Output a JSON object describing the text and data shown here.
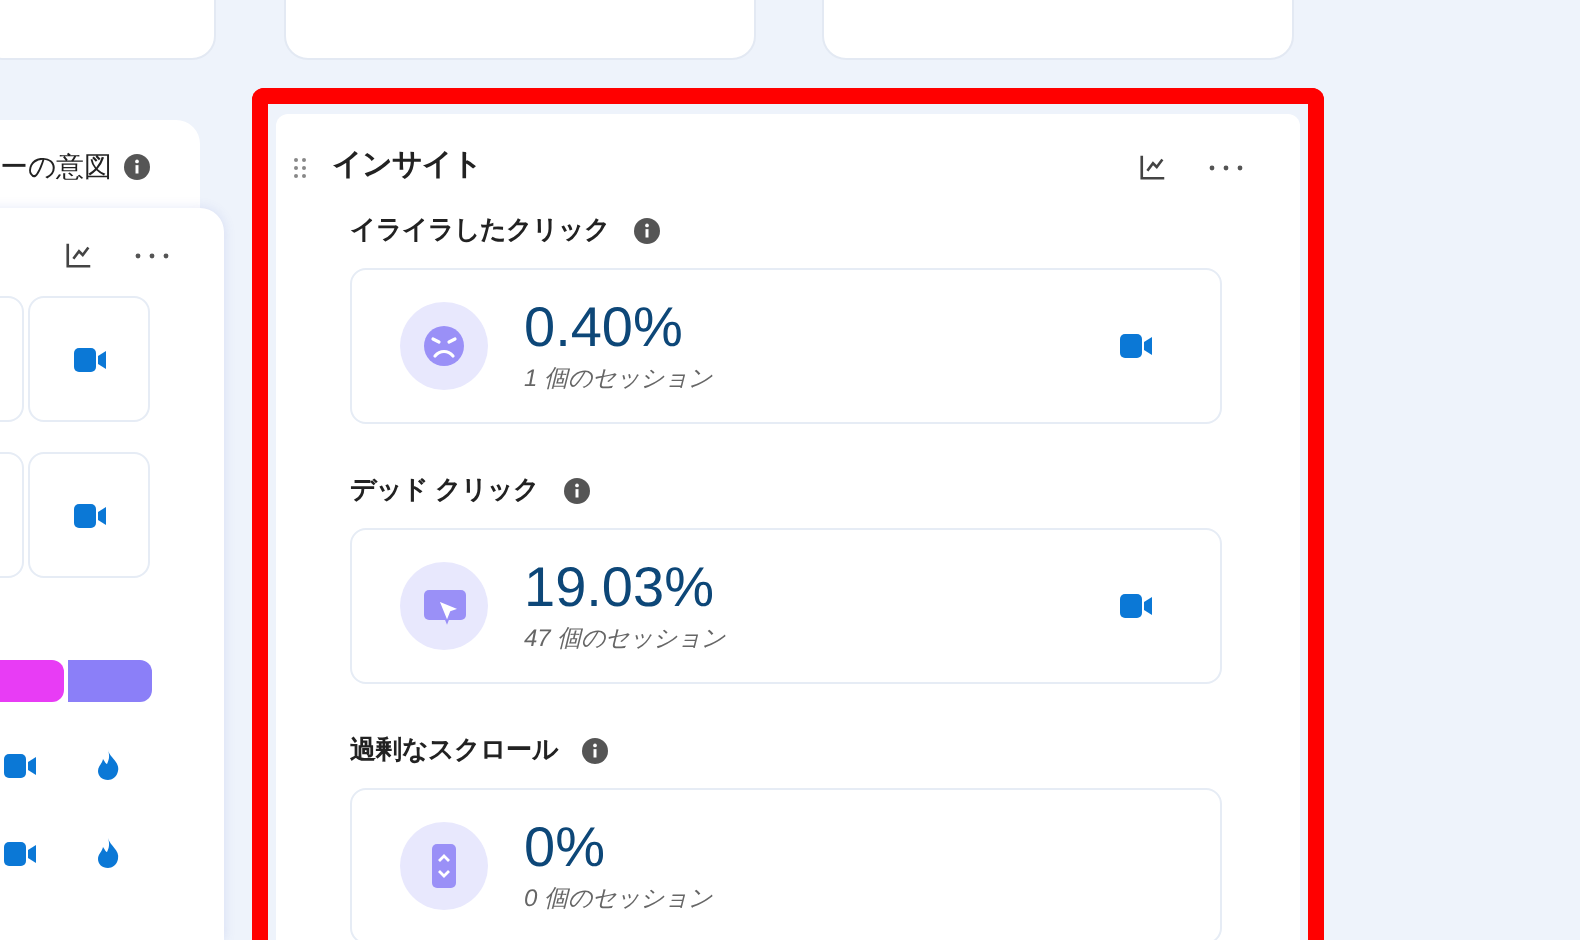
{
  "left_panel": {
    "title": "ーの意図"
  },
  "left_card": {
    "segments": [
      {
        "color": "#e83cf5"
      },
      {
        "color": "#8b7ff8"
      }
    ],
    "rows": [
      {
        "recording": true,
        "heatmap": true
      },
      {
        "recording": true,
        "heatmap": true
      }
    ]
  },
  "insights": {
    "title": "インサイト",
    "metrics": [
      {
        "kind": "frustrated",
        "label": "イライラしたクリック",
        "value": "0.40%",
        "sessions": "1 個のセッション",
        "recording": true
      },
      {
        "kind": "dead",
        "label": "デッド クリック",
        "value": "19.03%",
        "sessions": "47 個のセッション",
        "recording": true
      },
      {
        "kind": "scroll",
        "label": "過剰なスクロール",
        "value": "0%",
        "sessions": "0 個のセッション",
        "recording": false
      }
    ]
  }
}
